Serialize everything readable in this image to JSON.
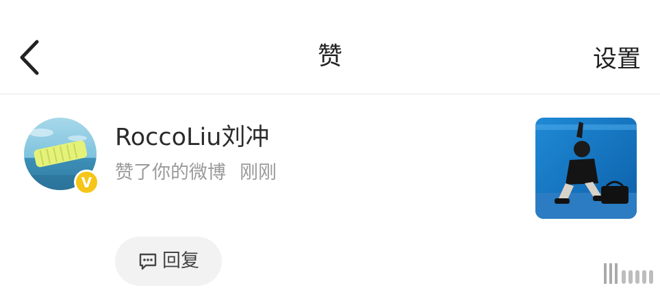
{
  "header": {
    "title": "赞",
    "settings_label": "设置",
    "back_icon": "chevron-left-icon"
  },
  "notification": {
    "username": "RoccoLiu刘冲",
    "action": "赞了你的微博",
    "time": "刚刚",
    "verified_badge_text": "V",
    "badge_color": "#f5c518"
  },
  "reply": {
    "label": "回复",
    "icon": "comment-bubble-icon"
  },
  "colors": {
    "title_text": "#222222",
    "secondary_text": "#9a9a9a",
    "divider": "#e6e6e6",
    "pill_background": "#f2f2f2"
  }
}
